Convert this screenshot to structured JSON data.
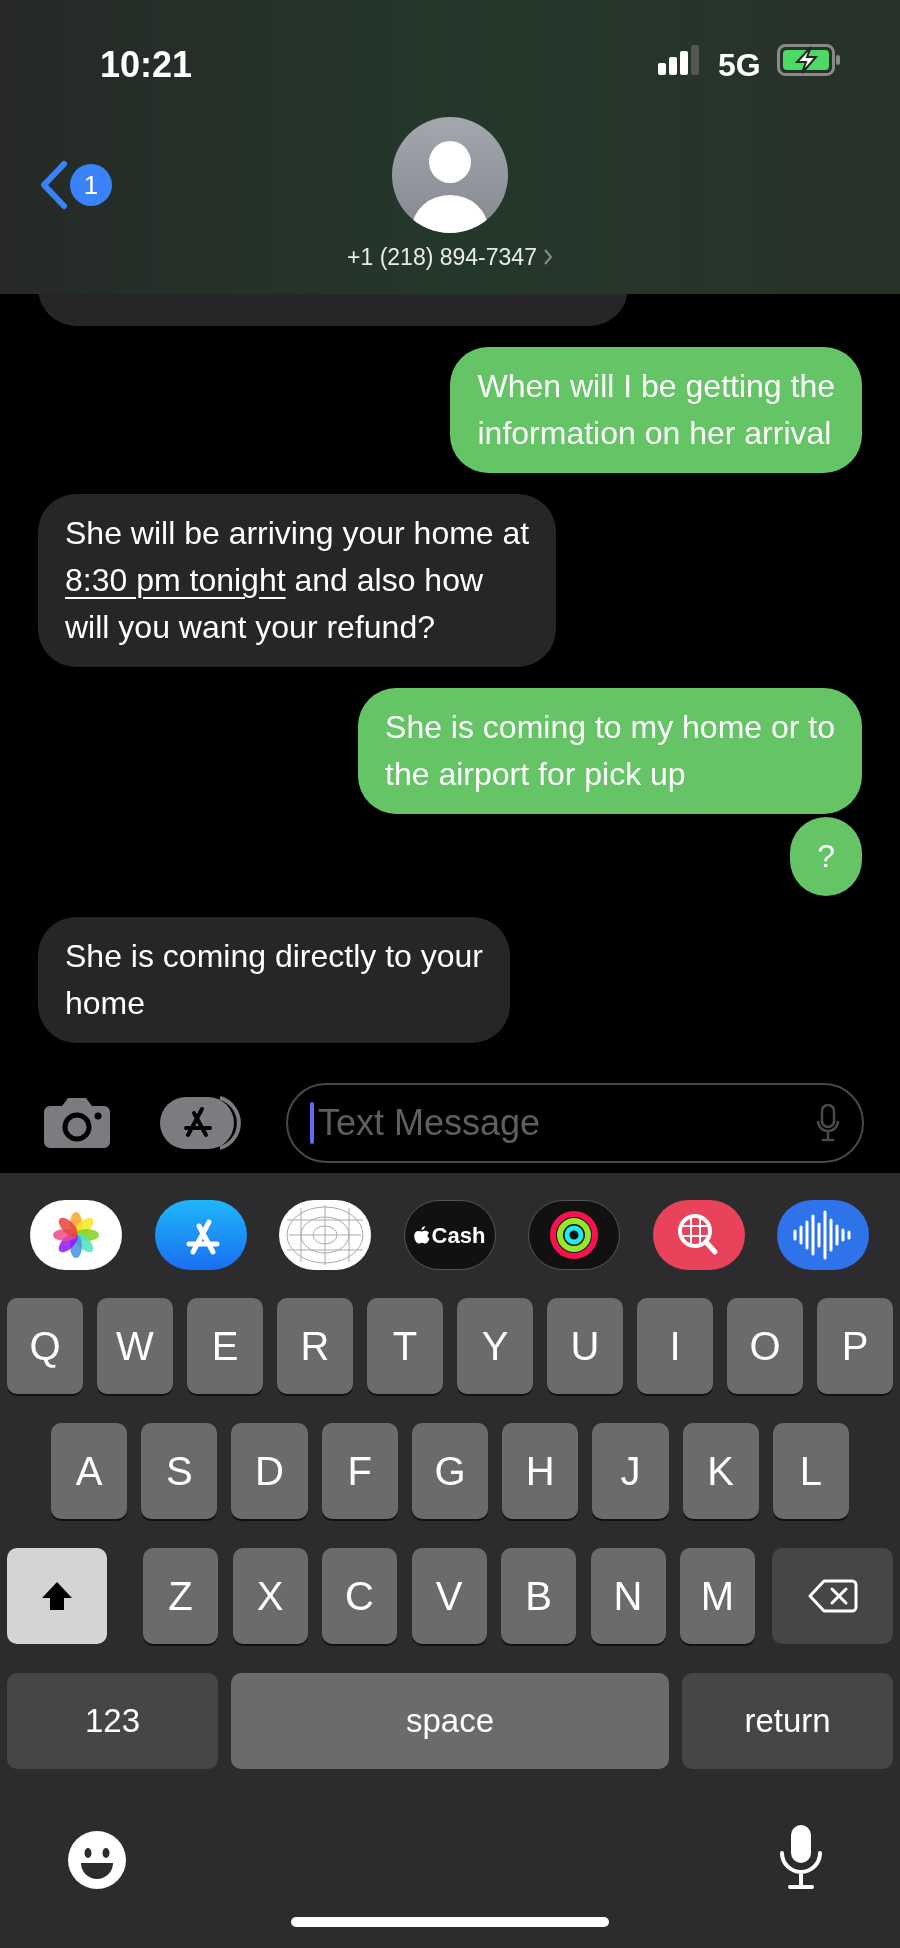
{
  "status_bar": {
    "time": "10:21",
    "network": "5G"
  },
  "header": {
    "unread_count": "1",
    "contact": "+1 (218) 894-7347"
  },
  "messages": [
    {
      "kind": "received",
      "cut_off": true
    },
    {
      "kind": "sent",
      "lines": [
        "When will I be getting the",
        "information on her arrival"
      ]
    },
    {
      "kind": "received",
      "lines": [
        [
          "She will be arriving your home at"
        ],
        [
          {
            "text": "8:30 pm tonight",
            "kind": "link"
          },
          " and also how"
        ],
        [
          "will you want your refund?"
        ]
      ]
    },
    {
      "kind": "sent",
      "lines": [
        "She is coming to my home or to",
        "the airport for pick up"
      ]
    },
    {
      "kind": "sent",
      "lines": [
        "?"
      ]
    },
    {
      "kind": "received",
      "lines": [
        "She is coming directly to your",
        "home"
      ]
    }
  ],
  "composer": {
    "placeholder": "Text Message"
  },
  "app_drawer": {
    "cash_label": "Cash"
  },
  "keyboard": {
    "rows": [
      [
        "Q",
        "W",
        "E",
        "R",
        "T",
        "Y",
        "U",
        "I",
        "O",
        "P"
      ],
      [
        "A",
        "S",
        "D",
        "F",
        "G",
        "H",
        "J",
        "K",
        "L"
      ],
      [
        "Z",
        "X",
        "C",
        "V",
        "B",
        "N",
        "M"
      ]
    ],
    "shift_on": true,
    "numbers_key": "123",
    "space_key": "space",
    "return_key": "return"
  }
}
